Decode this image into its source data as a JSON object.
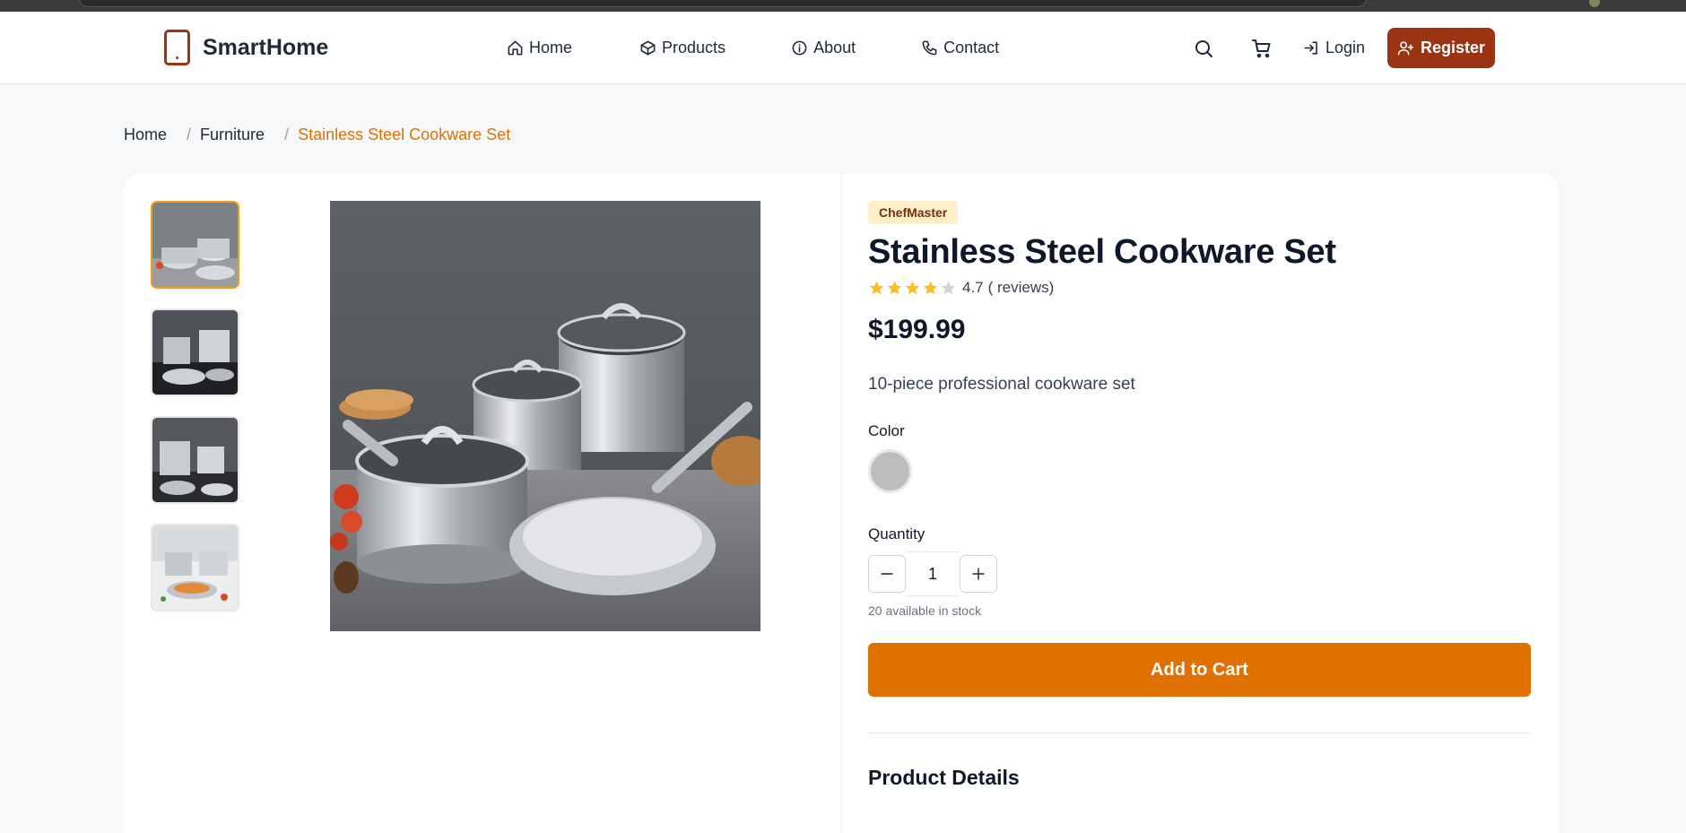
{
  "nav": {
    "brand": "SmartHome",
    "links": [
      {
        "label": "Home",
        "icon": "home-icon"
      },
      {
        "label": "Products",
        "icon": "box-icon"
      },
      {
        "label": "About",
        "icon": "info-icon"
      },
      {
        "label": "Contact",
        "icon": "phone-icon"
      }
    ],
    "search_icon": "search-icon",
    "cart_icon": "cart-icon",
    "login": "Login",
    "register": "Register"
  },
  "breadcrumb": [
    "Home",
    "Furniture",
    "Stainless Steel Cookware Set"
  ],
  "product": {
    "brand": "ChefMaster",
    "title": "Stainless Steel Cookware Set",
    "rating": 4.7,
    "rating_text": "4.7",
    "reviews_text": "( reviews)",
    "price": "$199.99",
    "description": "10-piece professional cookware set",
    "color_label": "Color",
    "colors": [
      "#bdbdbd"
    ],
    "quantity_label": "Quantity",
    "quantity": "1",
    "stock": "20 available in stock",
    "add_to_cart": "Add to Cart",
    "details_title": "Product Details",
    "selected_thumbnail": 0,
    "thumbnail_count": 4
  },
  "colors": {
    "brand": "#9a3412",
    "accent": "#e07000",
    "star": "#fbbf24"
  }
}
